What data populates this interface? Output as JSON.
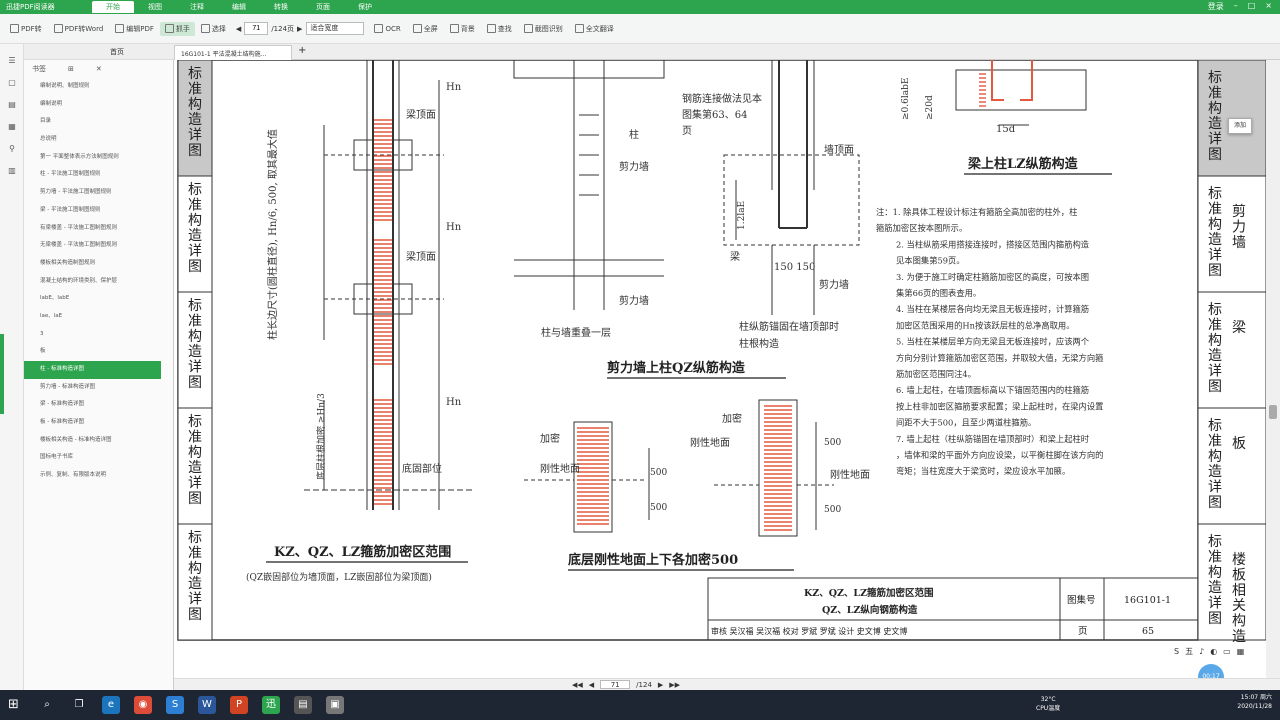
{
  "app": {
    "title": "迅捷PDF阅读器",
    "menus": [
      "开始",
      "视图",
      "注释",
      "编辑",
      "转换",
      "页面",
      "保护"
    ],
    "active_menu": "开始",
    "right": [
      "登录",
      "–",
      "□",
      "×"
    ]
  },
  "toolbar": {
    "items": [
      {
        "icon": "pdf-icon",
        "label": "PDF转"
      },
      {
        "icon": "pdf-to-word-icon",
        "label": "PDF转Word"
      },
      {
        "icon": "edit-pdf-icon",
        "label": "编辑PDF"
      },
      {
        "icon": "hand-icon",
        "label": "抓手",
        "active": true
      },
      {
        "icon": "select-icon",
        "label": "选择"
      }
    ],
    "page_current": "71",
    "page_total": "/124页",
    "zoom": "适合宽度",
    "tools": [
      {
        "icon": "ocr-icon",
        "label": "OCR"
      },
      {
        "icon": "fullscreen-icon",
        "label": "全屏"
      },
      {
        "icon": "background-icon",
        "label": "背景"
      },
      {
        "icon": "find-icon",
        "label": "查找"
      },
      {
        "icon": "screenshot-icon",
        "label": "截图识别"
      },
      {
        "icon": "translate-icon",
        "label": "全文翻译"
      }
    ]
  },
  "panel": {
    "head": "首页",
    "outline_title": "书签",
    "items": [
      "编制说明、制图规则",
      "编制说明",
      "目录",
      "总说明",
      "第一 平面整体表示方法制图规则",
      "柱 - 平法施工图制图规则",
      "剪力墙 - 平法施工图制图规则",
      "梁 - 平法施工图制图规则",
      "有梁楼盖 - 平法施工图制图规则",
      "无梁楼盖 - 平法施工图制图规则",
      "楼板相关构造制图规则",
      "混凝土结构的环境类别、保护层",
      "labE、labE",
      "lae、laE",
      "3",
      "板",
      "柱 - 标准构造详图",
      "剪力墙 - 标准构造详图",
      "梁 - 标准构造详图",
      "板 - 标准构造详图",
      "楼板相关构造 - 标准构造详图",
      "国标电子书库",
      "示例、复制、有限版本说明"
    ],
    "selected": 16
  },
  "tab": {
    "label": "16G101-1 平法混凝土结构施...",
    "plus": "+"
  },
  "drawing": {
    "left_tabs": [
      "标准构造详图",
      "标准构造详图",
      "标准构造详图",
      "标准构造详图",
      "标准构造详图"
    ],
    "right_tabs": [
      {
        "text": "标准构造详图",
        "side": ""
      },
      {
        "text": "标准构造详图",
        "side": "剪力墙"
      },
      {
        "text": "标准构造详图",
        "side": "梁"
      },
      {
        "text": "标准构造详图",
        "side": "板"
      },
      {
        "text": "标准构造详图",
        "side": "楼板相关构造"
      }
    ],
    "dim_text": "柱长边尺寸(圆柱直径), Hn/6, 500, 取其最大值",
    "bottom_dim": "底层柱根加密 ≥Hn/3",
    "labels": {
      "hn": "Hn",
      "beam_top": "梁顶面",
      "base": "底固部位",
      "col": "柱",
      "shear_wall": "剪力墙",
      "splice_note": "钢筋连接做法见本图集第63、64页",
      "wall_top": "墙顶面",
      "lap": "1.2laE",
      "beam": "梁",
      "dims150": "150 150",
      "col_overlap": "柱与墙重叠一层",
      "anchor_note": "柱纵筋锚固在墙顶部时柱根构造",
      "dense": "加密",
      "rigid": "刚性地面",
      "d500": "500",
      "beam_col_top": "≥0.6labE",
      "beam_col_dim": "≥20d",
      "d15": "15d"
    },
    "titles": {
      "t1": "KZ、QZ、LZ箍筋加密区范围",
      "t1_sub": "(QZ嵌固部位为墙顶面，LZ嵌固部位为梁顶面)",
      "t2": "底层刚性地面上下各加密500",
      "t3": "剪力墙上柱QZ纵筋构造",
      "t4": "梁上柱LZ纵筋构造"
    },
    "notes": [
      "注：1. 除具体工程设计标注有箍筋全高加密的柱外，柱箍筋加密区按本图所示。",
      "2. 当柱纵筋采用搭接连接时，搭接区范围内箍筋构造见本图集第59页。",
      "3. 为便于施工时确定柱箍筋加密区的高度，可按本图集第66页的图表查用。",
      "4. 当柱在某楼层各向均无梁且无板连接时，计算箍筋加密区范围采用的Hn按该跃层柱的总净高取用。",
      "5. 当柱在某楼层单方向无梁且无板连接时，应该两个方向分别计算箍筋加密区范围，并取较大值，无梁方向箍筋加密区范围同注4。",
      "6. 墙上起柱，在墙顶面标高以下锚固范围内的柱箍筋按上柱非加密区箍筋要求配置；梁上起柱时，在梁内设置间距不大于500，且至少两道柱箍筋。",
      "7. 墙上起柱（柱纵筋锚固在墙顶部时）和梁上起柱时，墙体和梁的平面外方向应设梁，以平衡柱脚在该方向的弯矩；当柱宽度大于梁宽时，梁应设水平加腋。"
    ],
    "titleblock": {
      "name1": "KZ、QZ、LZ箍筋加密区范围",
      "name2": "QZ、LZ纵向钢筋构造",
      "atlas_label": "图集号",
      "atlas": "16G101-1",
      "row": [
        "审核",
        "吴汉福",
        "吴汉福",
        "校对",
        "罗斌",
        "罗斌",
        "设计",
        "史文博",
        "史文博"
      ],
      "page_label": "页",
      "page": "65"
    }
  },
  "statusbar": {
    "page": "71",
    "total": "/124",
    "nav": [
      "◀◀",
      "◀",
      "▶",
      "▶▶"
    ]
  },
  "float": {
    "bubble": "00:17",
    "popup_title": "添加",
    "bar": [
      "S",
      "五",
      "♪",
      "◐",
      "▭",
      "▦"
    ]
  },
  "taskbar": {
    "start": "⊞",
    "temp": "32°C",
    "cpu": "CPU温度",
    "time": "15:07 周六",
    "date": "2020/11/28",
    "icons": [
      {
        "name": "search-icon",
        "glyph": "⌕",
        "color": "#1f2633"
      },
      {
        "name": "task-view-icon",
        "glyph": "❐",
        "color": "#1f2633"
      },
      {
        "name": "browser-icon",
        "glyph": "e",
        "color": "#1b75bc"
      },
      {
        "name": "chrome-icon",
        "glyph": "◉",
        "color": "#dd4b39"
      },
      {
        "name": "app-icon",
        "glyph": "S",
        "color": "#2d7fd3"
      },
      {
        "name": "app-icon-2",
        "glyph": "W",
        "color": "#2b579a"
      },
      {
        "name": "app-icon-3",
        "glyph": "P",
        "color": "#d04423"
      },
      {
        "name": "pdf-app-icon",
        "glyph": "迅",
        "color": "#2da44e"
      },
      {
        "name": "app-icon-4",
        "glyph": "▤",
        "color": "#555"
      },
      {
        "name": "app-icon-5",
        "glyph": "▣",
        "color": "#777"
      }
    ]
  }
}
